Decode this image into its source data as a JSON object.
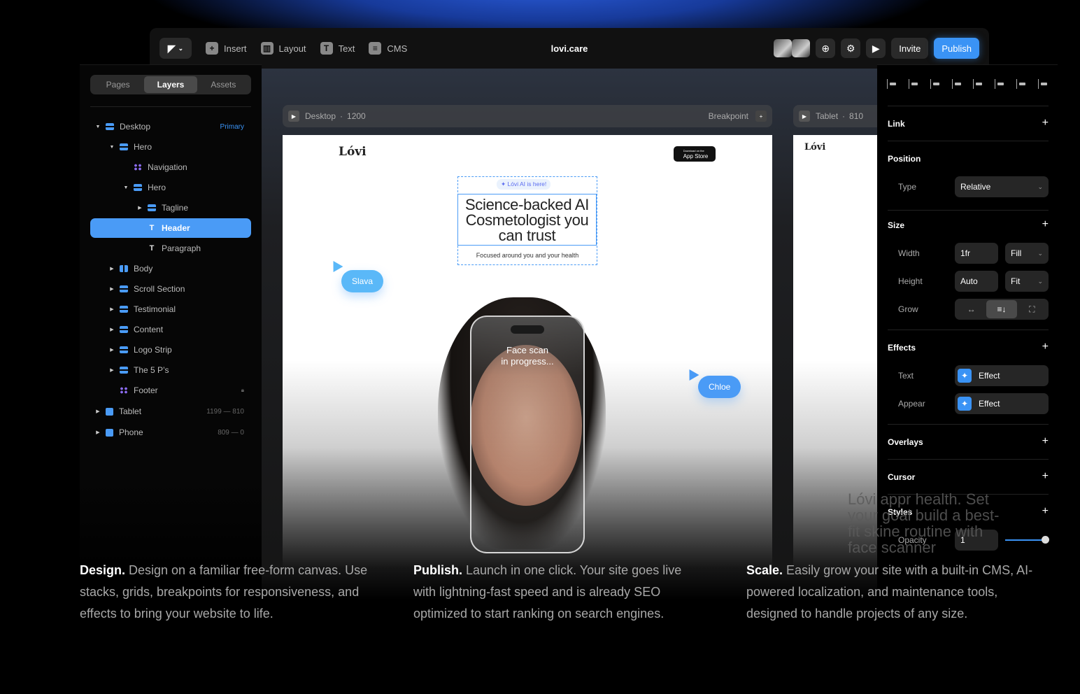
{
  "toolbar": {
    "menu": [
      "Insert",
      "Layout",
      "Text",
      "CMS"
    ],
    "menu_icons": [
      "plus-icon",
      "layout-icon",
      "text-icon",
      "database-icon"
    ],
    "site_title": "lovi.care",
    "invite_label": "Invite",
    "publish_label": "Publish"
  },
  "left_panel": {
    "tabs": [
      "Pages",
      "Layers",
      "Assets"
    ],
    "active_tab": "Layers",
    "layers": [
      {
        "label": "Desktop",
        "icon": "stack",
        "depth": 0,
        "caret": "open",
        "meta": "Primary"
      },
      {
        "label": "Hero",
        "icon": "stack",
        "depth": 1,
        "caret": "open"
      },
      {
        "label": "Navigation",
        "icon": "component",
        "depth": 2,
        "caret": ""
      },
      {
        "label": "Hero",
        "icon": "stack",
        "depth": 2,
        "caret": "open"
      },
      {
        "label": "Tagline",
        "icon": "stack",
        "depth": 3,
        "caret": "closed"
      },
      {
        "label": "Header",
        "icon": "text",
        "depth": 3,
        "caret": "",
        "selected": true
      },
      {
        "label": "Paragraph",
        "icon": "text",
        "depth": 3,
        "caret": ""
      },
      {
        "label": "Body",
        "icon": "columns",
        "depth": 1,
        "caret": "closed"
      },
      {
        "label": "Scroll Section",
        "icon": "stack",
        "depth": 1,
        "caret": "closed"
      },
      {
        "label": "Testimonial",
        "icon": "stack",
        "depth": 1,
        "caret": "closed"
      },
      {
        "label": "Content",
        "icon": "stack",
        "depth": 1,
        "caret": "closed"
      },
      {
        "label": "Logo Strip",
        "icon": "stack",
        "depth": 1,
        "caret": "closed"
      },
      {
        "label": "The 5 P’s",
        "icon": "stack",
        "depth": 1,
        "caret": "closed"
      },
      {
        "label": "Footer",
        "icon": "component",
        "depth": 1,
        "caret": "",
        "locked": true
      },
      {
        "label": "Tablet",
        "icon": "frame",
        "depth": 0,
        "caret": "closed",
        "meta": "1199 — 810"
      },
      {
        "label": "Phone",
        "icon": "frame",
        "depth": 0,
        "caret": "closed",
        "meta": "809 — 0"
      }
    ]
  },
  "canvas": {
    "desktop_label": "Desktop",
    "desktop_width": "1200",
    "breakpoint_label": "Breakpoint",
    "tablet_label": "Tablet",
    "tablet_width": "810",
    "site": {
      "logo": "Lóvi",
      "app_store_small": "Download on the",
      "app_store": "App Store",
      "badge": "✦ Lóvi AI is here!",
      "headline": "Science-backed AI Cosmetologist you can trust",
      "paragraph": "Focused around you and your health",
      "scan_text_1": "Face scan",
      "scan_text_2": "in progress...",
      "tablet_text": "Lóvi appr health. Set your goal build a best-fit skine routine with face scanner"
    },
    "cursors": [
      {
        "name": "Slava",
        "color": "#5ab8f8"
      },
      {
        "name": "Chloe",
        "color": "#4a9bf6"
      }
    ]
  },
  "right_panel": {
    "sections": {
      "link": "Link",
      "position": "Position",
      "size": "Size",
      "effects": "Effects",
      "overlays": "Overlays",
      "cursor": "Cursor",
      "styles": "Styles"
    },
    "type_label": "Type",
    "type_value": "Relative",
    "width_label": "Width",
    "width_value": "1fr",
    "width_mode": "Fill",
    "height_label": "Height",
    "height_value": "Auto",
    "height_mode": "Fit",
    "grow_label": "Grow",
    "grow_options": [
      "↔",
      "≡↓",
      "⛶"
    ],
    "grow_selected": 1,
    "text_label": "Text",
    "text_effect": "Effect",
    "appear_label": "Appear",
    "appear_effect": "Effect",
    "opacity_label": "Opacity",
    "opacity_value": "1",
    "opacity_slider": 1.0
  },
  "copy": [
    {
      "title": "Design.",
      "body": " Design on a familiar free-form canvas. Use stacks, grids, breakpoints for responsiveness, and effects to bring your website to life."
    },
    {
      "title": "Publish.",
      "body": " Launch in one click. Your site goes live with lightning-fast speed and is already SEO optimized to start ranking on search engines."
    },
    {
      "title": "Scale.",
      "body": " Easily grow your site with a built-in CMS, AI-powered localization, and maintenance tools, designed to handle projects of any size."
    }
  ],
  "colors": {
    "accent": "#3a93f5",
    "component": "#8b6cf0",
    "panel": "#000000",
    "toolbar": "#111111"
  }
}
